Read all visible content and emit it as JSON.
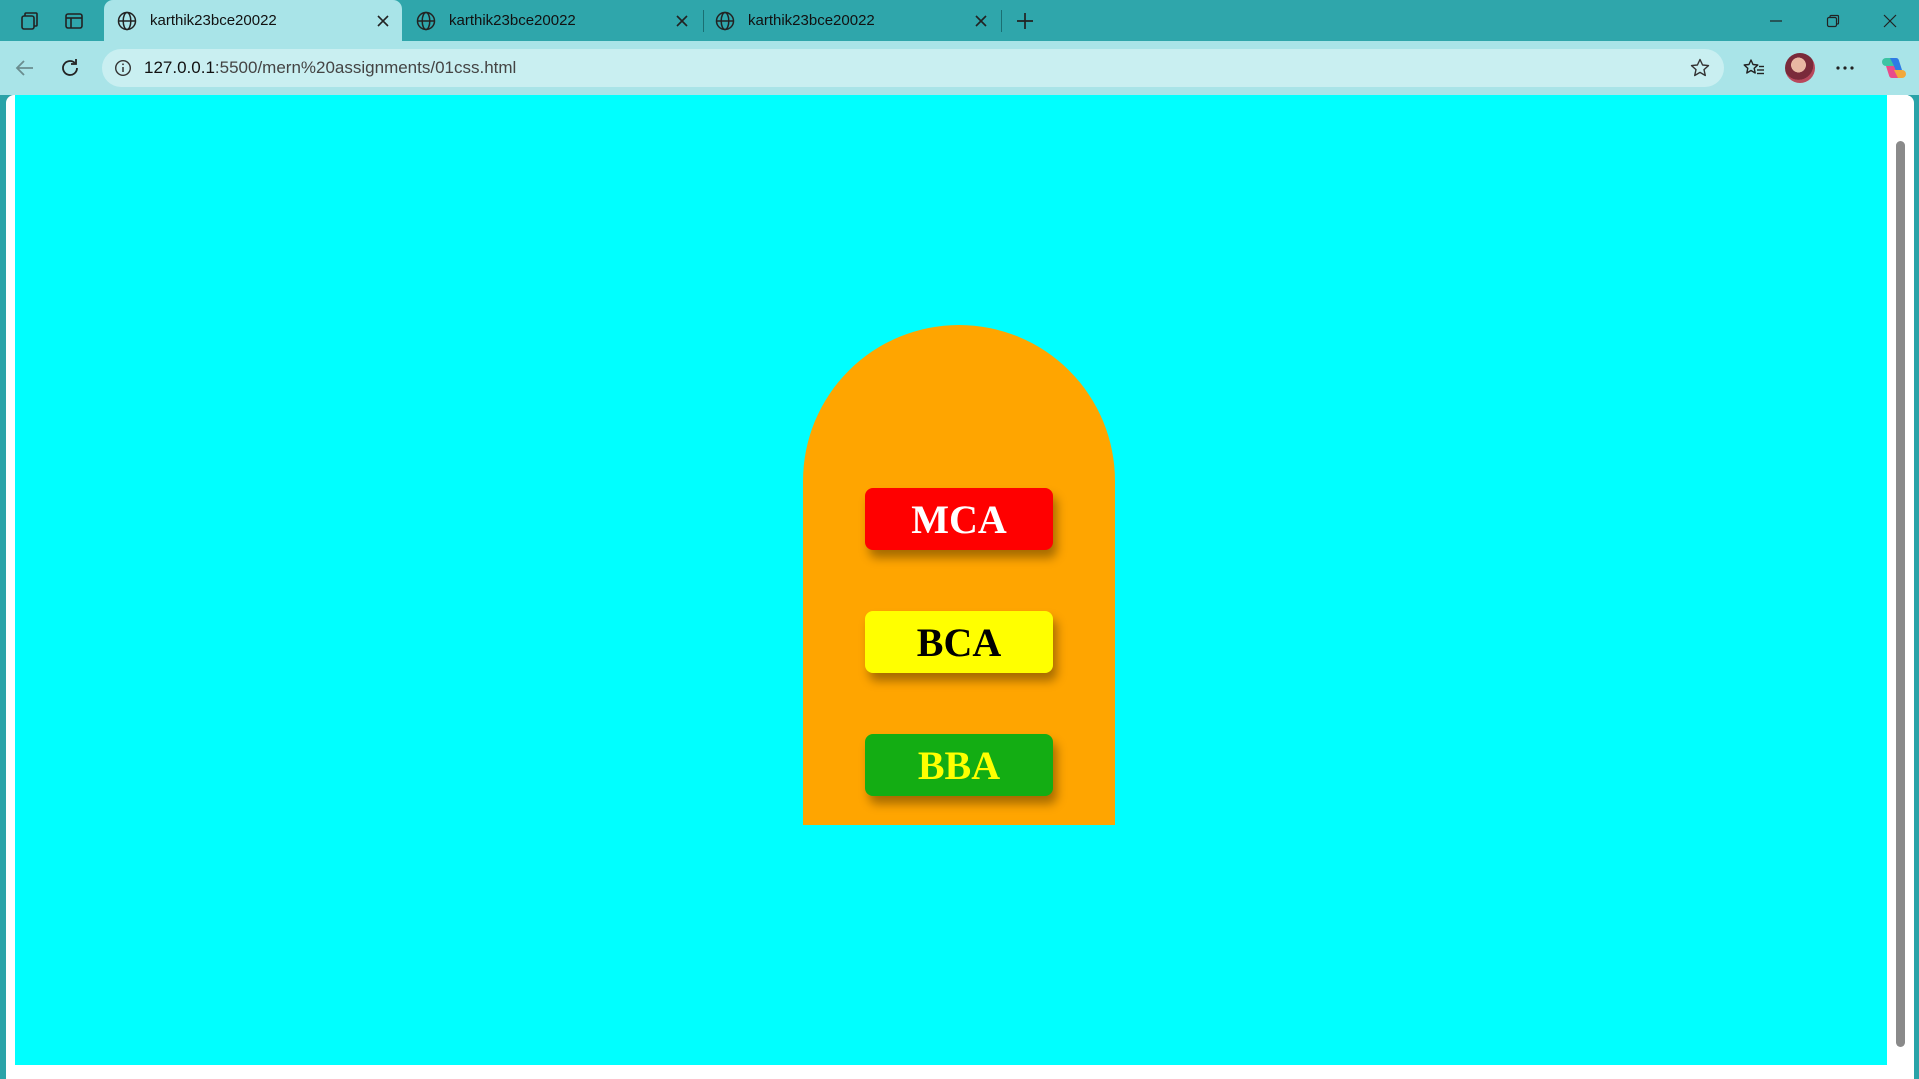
{
  "browser": {
    "tabs": [
      {
        "title": "karthik23bce20022",
        "active": true
      },
      {
        "title": "karthik23bce20022",
        "active": false
      },
      {
        "title": "karthik23bce20022",
        "active": false
      }
    ],
    "address": {
      "host": "127.0.0.1",
      "path": ":5500/mern%20assignments/01css.html"
    }
  },
  "page": {
    "background_color": "#00ffff",
    "container_color": "#ffa500",
    "buttons": [
      {
        "label": "MCA",
        "background": "#ff0000",
        "color": "#ffffff"
      },
      {
        "label": "BCA",
        "background": "#ffff00",
        "color": "#000000"
      },
      {
        "label": "BBA",
        "background": "#13ad13",
        "color": "#ffff00"
      }
    ]
  },
  "icons": {
    "workspaces": "workspaces-icon",
    "tab_actions": "tab-actions-icon",
    "new_tab": "plus-icon",
    "back": "back-arrow-icon",
    "refresh": "refresh-icon",
    "site_info": "info-icon",
    "favorite": "star-icon",
    "favorites": "favorites-icon",
    "more": "more-icon",
    "copilot": "copilot-icon"
  }
}
